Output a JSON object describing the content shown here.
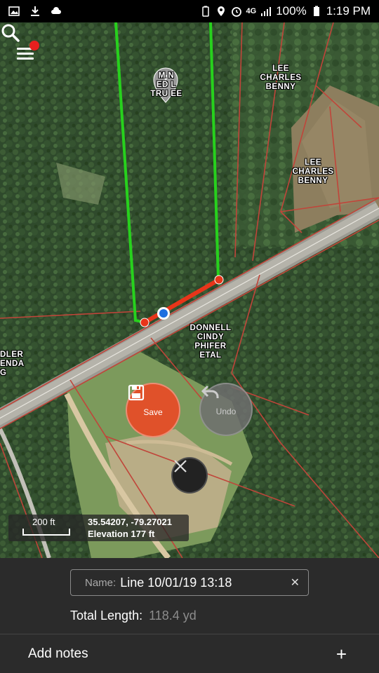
{
  "status_bar": {
    "network": "4G",
    "battery": "100%",
    "time": "1:19 PM"
  },
  "map": {
    "parcel_labels": [
      "M N\nED L\nTRU EE",
      "LEE\nCHARLES\nBENNY",
      "LEE\nCHARLES\nBENNY",
      "DONNELL\nCINDY\nPHIFER\nETAL",
      "DLER\nENDA\nG"
    ],
    "info_pin_glyph": "i",
    "scale": {
      "distance": "200 ft",
      "coordinates": "35.54207, -79.27021",
      "elevation": "Elevation 177 ft"
    },
    "save_label": "Save",
    "undo_label": "Undo",
    "colors": {
      "drawn_line": "#e8351a",
      "boundary_highlight": "#27d11d",
      "parcel_lines": "#c0453a",
      "save_button": "#e0512a"
    }
  },
  "panel": {
    "name_label": "Name:",
    "name_value": "Line 10/01/19 13:18",
    "total_label": "Total Length:",
    "total_value": "118.4 yd",
    "notes_label": "Add notes",
    "notes_plus": "+"
  }
}
